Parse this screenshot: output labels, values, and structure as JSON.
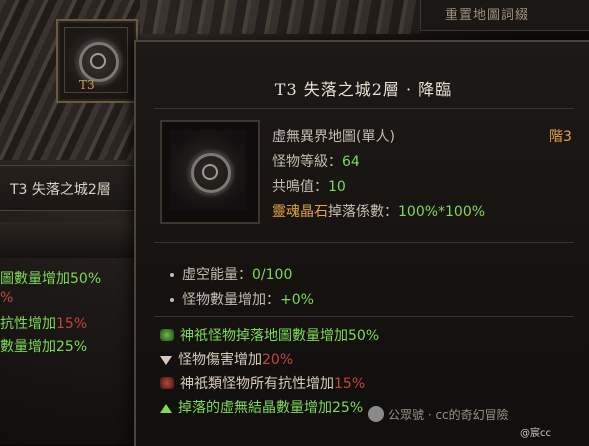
{
  "top_right_label": "重置地圖詞綴",
  "slot": {
    "tier": "T3",
    "icon": "map-gear-icon"
  },
  "left_panel": {
    "header": "T3 失落之城2層",
    "lines": [
      {
        "text": "圖數量增加",
        "value": "50%",
        "color": "#7ed957",
        "value_color": "#7ed957"
      },
      {
        "text": "%",
        "value": "",
        "color": "#c0473c",
        "value_color": "#c0473c"
      },
      {
        "text": "抗性增加",
        "value": "15%",
        "color": "#7ed957",
        "value_color": "#c0473c"
      },
      {
        "text": "數量增加",
        "value": "25%",
        "color": "#7ed957",
        "value_color": "#7ed957"
      }
    ]
  },
  "tooltip": {
    "title": "T3 失落之城2層 · 降臨",
    "item_type": "虛無異界地圖(單人)",
    "tier_label": "階3",
    "level_label": "怪物等級：",
    "level_value": "64",
    "resonance_label": "共鳴值：",
    "resonance_value": "10",
    "drop_name": "靈魂晶石",
    "drop_label": "掉落係數：",
    "drop_value": "100%*100%",
    "stats": [
      {
        "label": "虛空能量：",
        "value": "0/100"
      },
      {
        "label": "怪物數量增加：",
        "value": "+0%"
      }
    ],
    "affixes": [
      {
        "icon": "green-shield-icon",
        "text": "神祇怪物掉落地圖數量增加",
        "value": "50%",
        "text_color": "#7ed957",
        "value_color": "#7ed957"
      },
      {
        "icon": "down-triangle-icon",
        "text": "怪物傷害增加",
        "value": "20%",
        "text_color": "#d7cbbb",
        "value_color": "#c0473c"
      },
      {
        "icon": "red-shield-icon",
        "text": "神祇類怪物所有抗性增加",
        "value": "15%",
        "text_color": "#d7cbbb",
        "value_color": "#c0473c"
      },
      {
        "icon": "up-triangle-icon",
        "text": "掉落的虛無結晶數量增加",
        "value": "25%",
        "text_color": "#7ed957",
        "value_color": "#7ed957"
      }
    ]
  },
  "watermark": {
    "text": "公眾號 · cc的奇幻冒險",
    "corner": "@宸cc"
  }
}
